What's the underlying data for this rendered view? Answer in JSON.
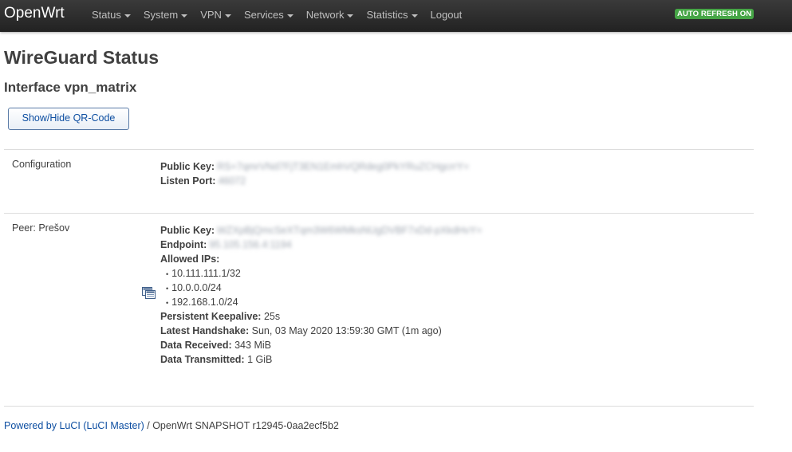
{
  "navbar": {
    "brand": "OpenWrt",
    "menu": [
      {
        "label": "Status",
        "dropdown": true
      },
      {
        "label": "System",
        "dropdown": true
      },
      {
        "label": "VPN",
        "dropdown": true
      },
      {
        "label": "Services",
        "dropdown": true
      },
      {
        "label": "Network",
        "dropdown": true
      },
      {
        "label": "Statistics",
        "dropdown": true
      },
      {
        "label": "Logout",
        "dropdown": false
      }
    ],
    "auto_refresh": "AUTO REFRESH ON"
  },
  "page": {
    "title": "WireGuard Status",
    "interface_title": "Interface vpn_matrix",
    "qr_button": "Show/Hide QR-Code"
  },
  "configuration": {
    "label": "Configuration",
    "public_key_label": "Public Key:",
    "public_key_value": "RS+7qmrVNd7FjT3EN1EmhVQRdeg0PkYRuZCHgcrrY=",
    "listen_port_label": "Listen Port:",
    "listen_port_value": "46072"
  },
  "peer": {
    "label": "Peer: Prešov",
    "icon": "peer-details-icon",
    "public_key_label": "Public Key:",
    "public_key_value": "WZXpBjQmcSeXTqm3W6WMksNUgDVBF7xDd-pXkdHvY=",
    "endpoint_label": "Endpoint:",
    "endpoint_value": "95.105.156.4:1194",
    "allowed_ips_label": "Allowed IPs:",
    "allowed_ips": [
      "10.111.111.1/32",
      "10.0.0.0/24",
      "192.168.1.0/24"
    ],
    "keepalive_label": "Persistent Keepalive:",
    "keepalive_value": "25s",
    "handshake_label": "Latest Handshake:",
    "handshake_value": "Sun, 03 May 2020 13:59:30 GMT (1m ago)",
    "received_label": "Data Received:",
    "received_value": "343 MiB",
    "transmitted_label": "Data Transmitted:",
    "transmitted_value": "1 GiB"
  },
  "footer": {
    "link": "Powered by LuCI (LuCI Master)",
    "text": "/ OpenWrt SNAPSHOT r12945-0aa2ecf5b2"
  },
  "colors": {
    "navbar": "#222222",
    "badge": "#46a546",
    "link": "#0d4ea1"
  }
}
